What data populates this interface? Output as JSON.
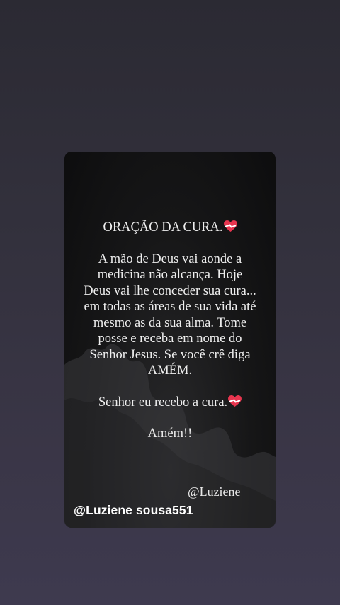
{
  "post": {
    "title": "ORAÇÃO DA CURA.",
    "body": "A mão de Deus vai aonde a medicina não alcança. Hoje Deus vai lhe conceder sua cura... em todas as áreas de sua vida até mesmo as da sua alma. Tome posse e receba em nome do Senhor Jesus. Se você crê diga AMÉM.",
    "response": "Senhor eu recebo a cura.",
    "amen": "Amém!!",
    "signature": "@Luziene",
    "heart_icon": "mending-heart-icon",
    "heart_color": "#e8354f"
  },
  "watermark": {
    "text": "@Luziene sousa551"
  },
  "colors": {
    "background_top": "#2b2a33",
    "background_bottom": "#3e3a4f",
    "card": "#0d0d0e",
    "text": "#eeeeee"
  }
}
